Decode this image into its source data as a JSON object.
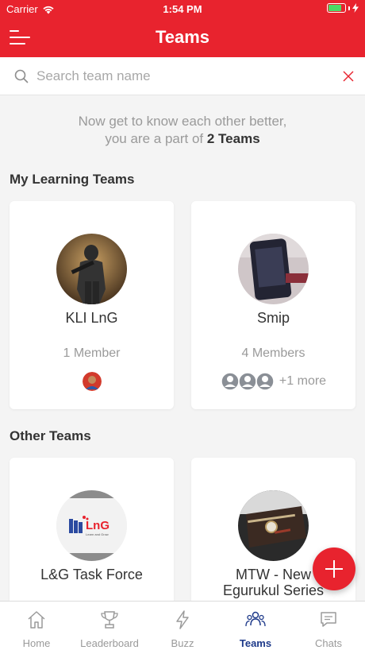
{
  "status_bar": {
    "carrier": "Carrier",
    "time": "1:54 PM",
    "battery_level": 0.8
  },
  "header": {
    "title": "Teams"
  },
  "search": {
    "placeholder": "Search team name",
    "value": ""
  },
  "intro": {
    "line1": "Now get to know each other better,",
    "line2_prefix": "you are a part of ",
    "line2_highlight": "2 Teams"
  },
  "sections": {
    "my_teams": "My Learning Teams",
    "other_teams": "Other Teams"
  },
  "my_teams": [
    {
      "name": "KLI LnG",
      "count": "1 Member"
    },
    {
      "name": "Smip",
      "count": "4 Members",
      "more": "+1 more"
    }
  ],
  "other_teams": [
    {
      "name": "L&G Task Force",
      "logo_text": "LnG",
      "logo_subtext": "Learn and Grow"
    },
    {
      "name": "MTW - New Egurukul Series"
    }
  ],
  "tabs": [
    {
      "label": "Home",
      "icon": "home-icon"
    },
    {
      "label": "Leaderboard",
      "icon": "trophy-icon"
    },
    {
      "label": "Buzz",
      "icon": "lightning-icon"
    },
    {
      "label": "Teams",
      "icon": "people-icon",
      "active": true
    },
    {
      "label": "Chats",
      "icon": "chat-icon"
    }
  ],
  "colors": {
    "brand": "#e8232e",
    "active_tab": "#1e3a8a",
    "muted": "#9a9a9a"
  }
}
